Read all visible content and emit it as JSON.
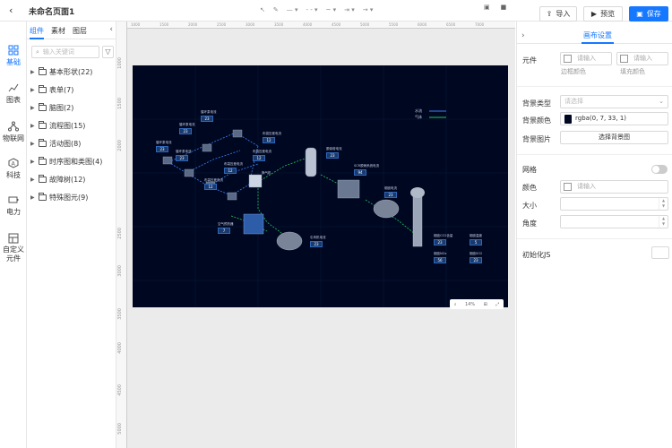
{
  "header": {
    "title": "未命名页面1",
    "import_label": "导入",
    "preview_label": "预览",
    "save_label": "保存"
  },
  "leftnav": {
    "items": [
      {
        "label": "基础",
        "icon": "grid-icon"
      },
      {
        "label": "图表",
        "icon": "chart-icon"
      },
      {
        "label": "物联网",
        "icon": "network-icon"
      },
      {
        "label": "科技",
        "icon": "hexagon-icon"
      },
      {
        "label": "电力",
        "icon": "battery-icon"
      },
      {
        "label": "自定义元件",
        "icon": "custom-icon"
      }
    ]
  },
  "components": {
    "tabs": [
      "组件",
      "素材",
      "图层"
    ],
    "search_placeholder": "输入关键词",
    "tree": [
      "基本形状(22)",
      "表单(7)",
      "脑图(2)",
      "流程图(15)",
      "活动图(8)",
      "时序图和类图(4)",
      "故障树(12)",
      "特殊图元(9)"
    ]
  },
  "rulers": {
    "top": [
      "1000",
      "1500",
      "2000",
      "2500",
      "3000",
      "3500",
      "4000",
      "4500",
      "5000",
      "5500",
      "6000",
      "6500",
      "7000"
    ],
    "left": [
      "1000",
      "1500",
      "2000",
      "2500",
      "3000",
      "3500",
      "4000",
      "4500",
      "5000"
    ]
  },
  "canvas": {
    "legend": [
      "水流",
      "气体"
    ],
    "zoom": "14%",
    "tags": [
      {
        "label": "循环泵电流",
        "value": "23"
      },
      {
        "label": "循环泵电流",
        "value": "23"
      },
      {
        "label": "循环泵电流",
        "value": "23"
      },
      {
        "label": "循环泵电流",
        "value": "23"
      },
      {
        "label": "布袋压差电流",
        "value": "12"
      },
      {
        "label": "布袋压差电流",
        "value": "12"
      },
      {
        "label": "布袋压差电流",
        "value": "12"
      },
      {
        "label": "布袋压差电流",
        "value": "12"
      },
      {
        "label": "换气机",
        "value": ""
      },
      {
        "label": "脱硫塔电流",
        "value": "23"
      },
      {
        "label": "SCR脱硝系统电流",
        "value": "94"
      },
      {
        "label": "烟囱电流",
        "value": "23"
      },
      {
        "label": "空气预热器",
        "value": "7"
      },
      {
        "label": "引风机电流",
        "value": "23"
      },
      {
        "label": "烟囱CO2含量",
        "value": "23"
      },
      {
        "label": "烟囱温度",
        "value": "5"
      },
      {
        "label": "烟囱NOx",
        "value": "56"
      },
      {
        "label": "烟囱SO2",
        "value": "23"
      }
    ]
  },
  "props": {
    "tab_title": "画布设置",
    "element_label": "元件",
    "border_input_placeholder": "请输入",
    "fill_input_placeholder": "请输入",
    "border_color_label": "边框颜色",
    "fill_color_label": "填充颜色",
    "bg_type_label": "背景类型",
    "bg_type_placeholder": "请选择",
    "bg_color_label": "背景颜色",
    "bg_color_value": "rgba(0, 7, 33, 1)",
    "bg_image_label": "背景图片",
    "bg_image_button": "选择背景图",
    "grid_label": "网格",
    "color_label": "颜色",
    "color_placeholder": "请输入",
    "size_label": "大小",
    "angle_label": "角度",
    "init_js_label": "初始化JS"
  },
  "colors": {
    "accent": "#1677ff",
    "canvas_bg": "#000721",
    "water_line": "#3b82f6",
    "gas_line": "#22c55e"
  }
}
